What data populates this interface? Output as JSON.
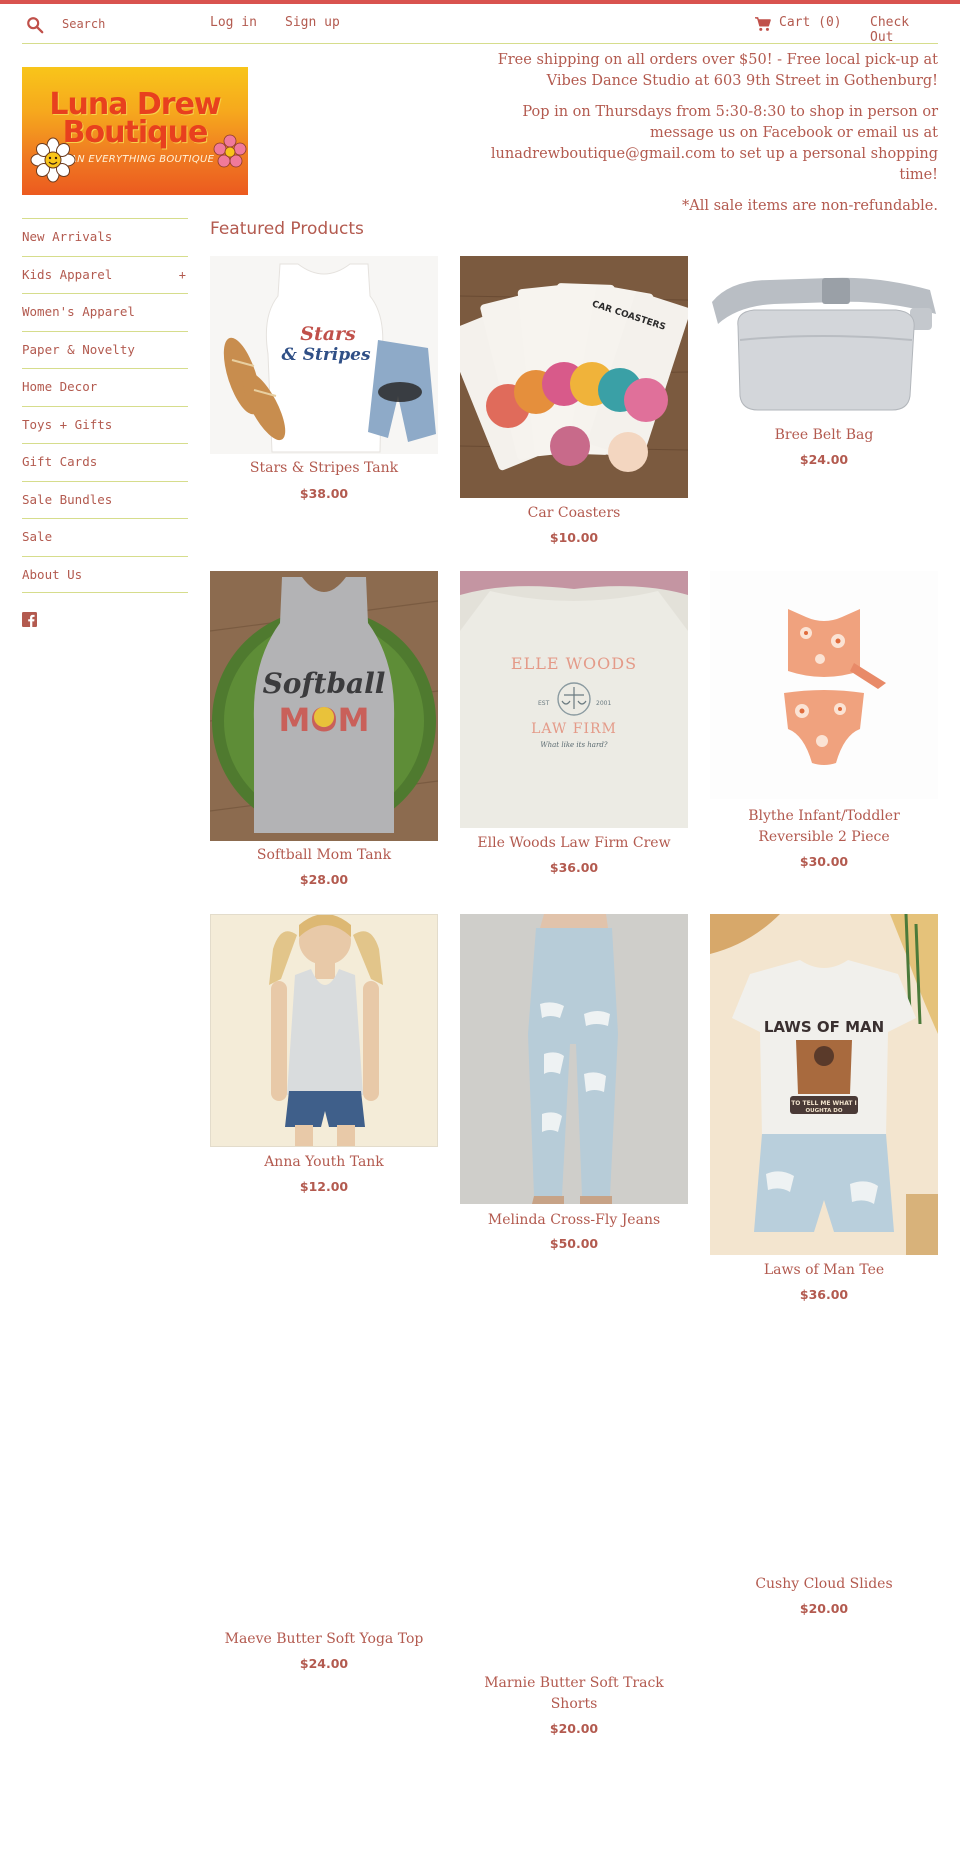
{
  "header": {
    "search_placeholder": "Search",
    "login": "Log in",
    "signup": "Sign up",
    "cart": "Cart (0)",
    "checkout": "Check Out"
  },
  "logo": {
    "line1": "Luna Drew",
    "line2": "Boutique",
    "tagline": "AN EVERYTHING BOUTIQUE"
  },
  "announcement": {
    "line1": "Free shipping on all orders over $50! - Free local pick-up at Vibes Dance Studio at 603 9th Street in Gothenburg!",
    "line2": "Pop in on Thursdays from 5:30-8:30 to shop in person or message us on Facebook or email us at lunadrewboutique@gmail.com to set up a personal shopping time!",
    "line3": "*All sale items are non-refundable."
  },
  "sidebar": {
    "items": [
      {
        "label": "New Arrivals"
      },
      {
        "label": "Kids Apparel",
        "expand": "+"
      },
      {
        "label": "Women's Apparel"
      },
      {
        "label": "Paper & Novelty"
      },
      {
        "label": "Home Decor"
      },
      {
        "label": "Toys + Gifts"
      },
      {
        "label": "Gift Cards"
      },
      {
        "label": "Sale Bundles"
      },
      {
        "label": "Sale"
      },
      {
        "label": "About Us"
      }
    ]
  },
  "featured_title": "Featured Products",
  "products": [
    {
      "name": "Stars & Stripes Tank",
      "price": "$38.00",
      "image_text_1": "Stars",
      "image_text_2": "& Stripes"
    },
    {
      "name": "Car Coasters",
      "price": "$10.00",
      "image_text_1": "CAR COASTERS"
    },
    {
      "name": "Bree Belt Bag",
      "price": "$24.00"
    },
    {
      "name": "Softball Mom Tank",
      "price": "$28.00",
      "image_text_1": "Softball",
      "image_text_2": "MOM"
    },
    {
      "name": "Elle Woods Law Firm Crew",
      "price": "$36.00",
      "image_text_1": "ELLE WOODS",
      "image_text_2": "LAW FIRM",
      "image_text_3": "What like its hard?",
      "image_text_4": "EST",
      "image_text_5": "2001"
    },
    {
      "name": "Blythe Infant/Toddler Reversible 2 Piece",
      "price": "$30.00"
    },
    {
      "name": "Anna Youth Tank",
      "price": "$12.00"
    },
    {
      "name": "Melinda Cross-Fly Jeans",
      "price": "$50.00"
    },
    {
      "name": "Laws of Man Tee",
      "price": "$36.00",
      "image_text_1": "LAWS OF MAN",
      "image_text_2": "TO TELL ME WHAT I",
      "image_text_3": "OUGHTA DO"
    },
    {
      "name": "Maeve Butter Soft Yoga Top",
      "price": "$24.00"
    },
    {
      "name": "Marnie Butter Soft Track Shorts",
      "price": "$20.00"
    },
    {
      "name": "Cushy Cloud Slides",
      "price": "$20.00"
    }
  ],
  "colors": {
    "accent": "#d9534f",
    "text": "#b35a4f",
    "divider": "#d6dd8c"
  }
}
